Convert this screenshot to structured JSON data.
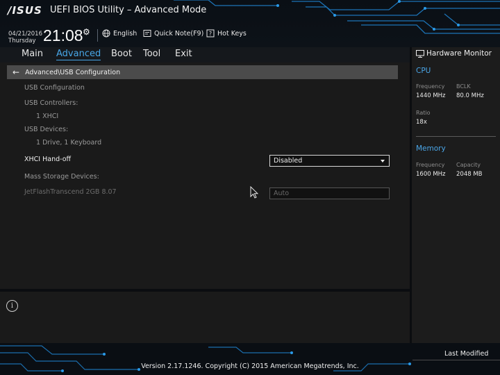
{
  "header": {
    "logo": "/ISUS",
    "title": "UEFI BIOS Utility – Advanced Mode",
    "date": "04/21/2016",
    "weekday": "Thursday",
    "time": "21:08",
    "language": "English",
    "quick_note": "Quick Note(F9)",
    "hot_keys": "Hot Keys"
  },
  "nav": {
    "tabs": [
      "Main",
      "Advanced",
      "Boot",
      "Tool",
      "Exit"
    ],
    "active": "Advanced"
  },
  "breadcrumb": "Advanced\\USB Configuration",
  "usb": {
    "section": "USB Configuration",
    "controllers_label": "USB Controllers:",
    "controllers_value": "1 XHCI",
    "devices_label": "USB Devices:",
    "devices_value": "1 Drive, 1 Keyboard",
    "xhci_label": "XHCI Hand-off",
    "xhci_value": "Disabled",
    "mass_storage_label": "Mass Storage Devices:",
    "drive_label": "JetFlashTranscend 2GB 8.07",
    "drive_value": "Auto"
  },
  "hardware_monitor": {
    "title": "Hardware Monitor",
    "cpu": {
      "heading": "CPU",
      "frequency_label": "Frequency",
      "frequency_value": "1440 MHz",
      "bclk_label": "BCLK",
      "bclk_value": "80.0 MHz",
      "ratio_label": "Ratio",
      "ratio_value": "18x"
    },
    "memory": {
      "heading": "Memory",
      "frequency_label": "Frequency",
      "frequency_value": "1600 MHz",
      "capacity_label": "Capacity",
      "capacity_value": "2048 MB"
    }
  },
  "footer": {
    "last_modified": "Last Modified",
    "version": "Version 2.17.1246. Copyright (C) 2015 American Megatrends, Inc."
  },
  "colors": {
    "accent": "#48a7e8",
    "panel": "#1a1a1a",
    "breadcrumb_bg": "#4b4b4b"
  },
  "icons": [
    "settings-gear-icon",
    "globe-icon",
    "note-icon",
    "help-question-icon",
    "back-arrow-icon",
    "monitor-icon",
    "info-icon",
    "dropdown-caret-icon",
    "mouse-pointer-icon"
  ]
}
